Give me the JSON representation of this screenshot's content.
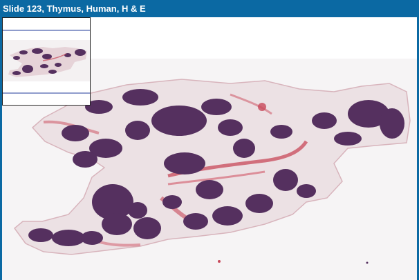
{
  "window": {
    "title": "Slide 123, Thymus, Human, H & E"
  },
  "navigator": {
    "label": "navigator-thumbnail"
  },
  "colors": {
    "title_bar": "#0b69a3",
    "lobule": "#55305f",
    "connective_tissue": "#e9d3d8",
    "vessel": "#c8485a",
    "background": "#ffffff"
  }
}
